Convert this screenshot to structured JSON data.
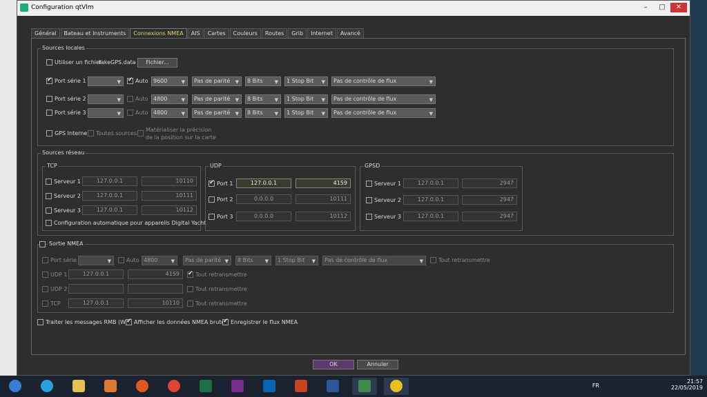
{
  "window": {
    "title": "Configuration qtVlm"
  },
  "tabs": [
    "Général",
    "Bateau et Instruments",
    "Connexions NMEA",
    "AIS",
    "Cartes",
    "Couleurs",
    "Routes",
    "Grib",
    "Internet",
    "Avancé"
  ],
  "local": {
    "title": "Sources locales",
    "use_file": "Utiliser un fichier",
    "file_name": "fakeGPS.data",
    "file_btn": "Fichier...",
    "ports": [
      {
        "label": "Port série 1",
        "checked": true,
        "auto_checked": true,
        "auto": "Auto",
        "baud": "9600",
        "parity": "Pas de parité",
        "bits": "8 Bits",
        "stop": "1 Stop Bit",
        "flow": "Pas de contrôle de flux"
      },
      {
        "label": "Port série 2",
        "checked": false,
        "auto_checked": false,
        "auto": "Auto",
        "baud": "4800",
        "parity": "Pas de parité",
        "bits": "8 Bits",
        "stop": "1 Stop Bit",
        "flow": "Pas de contrôle de flux"
      },
      {
        "label": "Port série 3",
        "checked": false,
        "auto_checked": false,
        "auto": "Auto",
        "baud": "4800",
        "parity": "Pas de parité",
        "bits": "8 Bits",
        "stop": "1 Stop Bit",
        "flow": "Pas de contrôle de flux"
      }
    ],
    "gps_interne": "GPS Interne",
    "toutes_sources": "Toutes sources",
    "materialiser1": "Matérialiser la précision",
    "materialiser2": "de la position sur la carte"
  },
  "network": {
    "title": "Sources réseau",
    "tcp": {
      "title": "TCP",
      "rows": [
        {
          "label": "Serveur 1",
          "ip": "127.0.0.1",
          "port": "10110"
        },
        {
          "label": "Serveur 2",
          "ip": "127.0.0.1",
          "port": "10111"
        },
        {
          "label": "Serveur 3",
          "ip": "127.0.0.1",
          "port": "10112"
        }
      ],
      "auto_config": "Configuration automatique pour appareils Digital Yacht"
    },
    "udp": {
      "title": "UDP",
      "rows": [
        {
          "label": "Port 1",
          "ip": "127.0.0.1",
          "port": "4159",
          "checked": true
        },
        {
          "label": "Port 2",
          "ip": "0.0.0.0",
          "port": "10111",
          "checked": false
        },
        {
          "label": "Port 3",
          "ip": "0.0.0.0",
          "port": "10112",
          "checked": false
        }
      ]
    },
    "gpsd": {
      "title": "GPSD",
      "rows": [
        {
          "label": "Serveur 1",
          "ip": "127.0.0.1",
          "port": "2947"
        },
        {
          "label": "Serveur 2",
          "ip": "127.0.0.1",
          "port": "2947"
        },
        {
          "label": "Serveur 3",
          "ip": "127.0.0.1",
          "port": "2947"
        }
      ]
    }
  },
  "output": {
    "title": "Sortie NMEA",
    "port_serie": "Port série",
    "auto": "Auto",
    "baud": "4800",
    "parity": "Pas de parité",
    "bits": "8 Bits",
    "stop": "1 Stop Bit",
    "flow": "Pas de contrôle de flux",
    "tout": "Tout retransmettre",
    "udp1": {
      "label": "UDP 1",
      "ip": "127.0.0.1",
      "port": "4159"
    },
    "udp2": {
      "label": "UDP 2"
    },
    "tcp": {
      "label": "TCP",
      "ip": "127.0.0.1",
      "port": "10110"
    }
  },
  "bottom": {
    "rmb": "Traiter les messages RMB (WP)",
    "afficher": "Afficher les données NMEA brutes",
    "enregistrer": "Enregistrer le flux NMEA"
  },
  "buttons": {
    "ok": "OK",
    "cancel": "Annuler"
  },
  "tray": {
    "lang": "FR",
    "time": "21:57",
    "date": "22/05/2019"
  },
  "colors": {
    "accent": "#e8d56a",
    "ok_bg": "#5a3d6a"
  }
}
